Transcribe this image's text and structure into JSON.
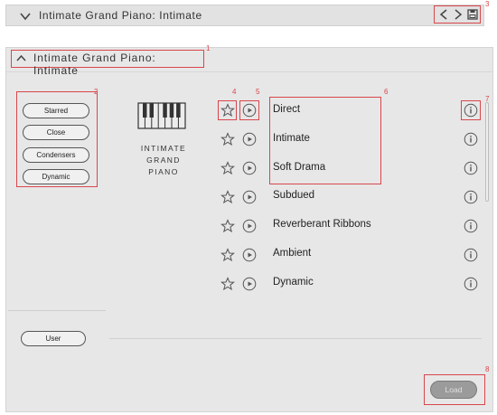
{
  "header": {
    "title": "Intimate Grand Piano: Intimate"
  },
  "panel": {
    "title": "Intimate Grand Piano: Intimate"
  },
  "callouts": [
    "1",
    "2",
    "3",
    "4",
    "5",
    "6",
    "7",
    "8"
  ],
  "tags": [
    "Starred",
    "Close",
    "Condensers",
    "Dynamic"
  ],
  "instrument": {
    "name_lines": [
      "INTIMATE",
      "GRAND",
      "PIANO"
    ]
  },
  "presets": [
    "Direct",
    "Intimate",
    "Soft Drama",
    "Subdued",
    "Reverberant Ribbons",
    "Ambient",
    "Dynamic"
  ],
  "user_button": "User",
  "load_button": "Load",
  "icons": {
    "collapse": "chevron-down-icon",
    "expand": "chevron-up-icon",
    "prev": "chevron-left-icon",
    "next": "chevron-right-icon",
    "save": "floppy-disk-icon",
    "star": "star-outline-icon",
    "play": "play-circle-icon",
    "info": "info-circle-icon"
  },
  "colors": {
    "callout": "#d9464c",
    "panel": "#e7e7e7",
    "load_disabled": "#9b9b9b"
  }
}
